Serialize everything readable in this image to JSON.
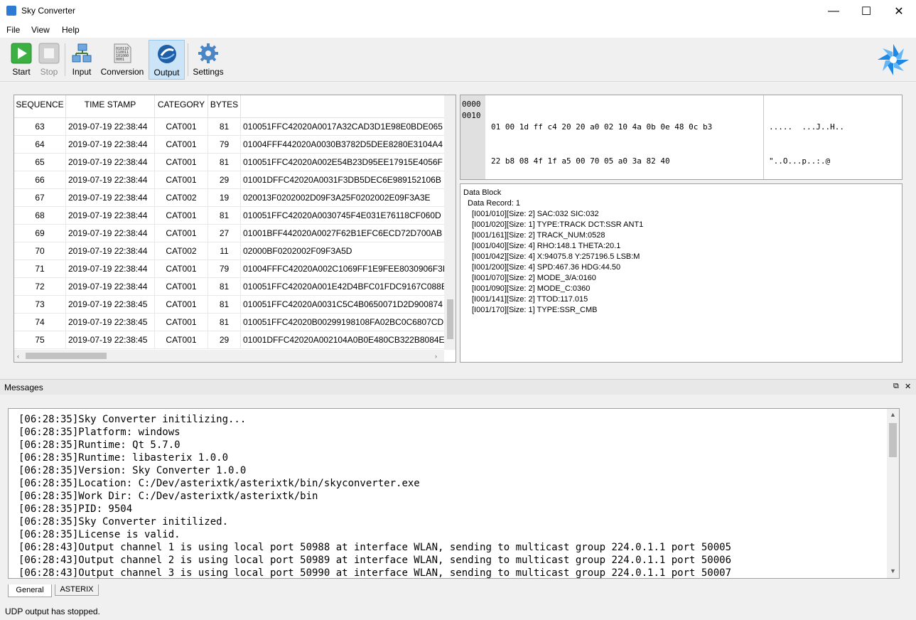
{
  "window": {
    "title": "Sky Converter",
    "minimize": "—",
    "maximize": "☐",
    "close": "✕"
  },
  "menu": [
    "File",
    "View",
    "Help"
  ],
  "toolbar": {
    "buttons": [
      {
        "label": "Start",
        "icon": "play-icon"
      },
      {
        "label": "Stop",
        "icon": "stop-icon"
      },
      {
        "label": "Input",
        "icon": "network-icon"
      },
      {
        "label": "Conversion",
        "icon": "binary-doc-icon"
      },
      {
        "label": "Output",
        "icon": "output-icon"
      },
      {
        "label": "Settings",
        "icon": "gear-icon"
      }
    ]
  },
  "table": {
    "headers": [
      "SEQUENCE",
      "TIME STAMP",
      "CATEGORY",
      "BYTES",
      ""
    ],
    "rows": [
      [
        "63",
        "2019-07-19 22:38:44",
        "CAT001",
        "81",
        "010051FFC42020A0017A32CAD3D1E98E0BDE065"
      ],
      [
        "64",
        "2019-07-19 22:38:44",
        "CAT001",
        "79",
        "01004FFF442020A0030B3782D5DEE8280E3104A4"
      ],
      [
        "65",
        "2019-07-19 22:38:44",
        "CAT001",
        "81",
        "010051FFC42020A002E54B23D95EE17915E4056F"
      ],
      [
        "66",
        "2019-07-19 22:38:44",
        "CAT001",
        "29",
        "01001DFFC42020A0031F3DB5DEC6E989152106B"
      ],
      [
        "67",
        "2019-07-19 22:38:44",
        "CAT002",
        "19",
        "020013F0202002D09F3A25F0202002E09F3A3E"
      ],
      [
        "68",
        "2019-07-19 22:38:44",
        "CAT001",
        "81",
        "010051FFC42020A0030745F4E031E76118CF060D"
      ],
      [
        "69",
        "2019-07-19 22:38:44",
        "CAT001",
        "27",
        "01001BFF442020A0027F62B1EFC6ECD72D700AB"
      ],
      [
        "70",
        "2019-07-19 22:38:44",
        "CAT002",
        "11",
        "02000BF0202002F09F3A5D"
      ],
      [
        "71",
        "2019-07-19 22:38:44",
        "CAT001",
        "79",
        "01004FFFC42020A002C1069FF1E9FEE8030906F3D"
      ],
      [
        "72",
        "2019-07-19 22:38:44",
        "CAT001",
        "81",
        "010051FFC42020A001E42D4BFC01FDC9167C088E"
      ],
      [
        "73",
        "2019-07-19 22:38:45",
        "CAT001",
        "81",
        "010051FFC42020A0031C5C4B0650071D2D900874"
      ],
      [
        "74",
        "2019-07-19 22:38:45",
        "CAT001",
        "81",
        "010051FFC42020B00299198108FA02BC0C6807CD"
      ],
      [
        "75",
        "2019-07-19 22:38:45",
        "CAT001",
        "29",
        "01001DFFC42020A002104A0B0E480CB322B8084E"
      ]
    ]
  },
  "hex": {
    "offsets": [
      "0000",
      "0010"
    ],
    "bytes": [
      "01 00 1d ff c4 20 20 a0 02 10 4a 0b 0e 48 0c b3",
      "22 b8 08 4f 1f a5 00 70 05 a0 3a 82 40"
    ],
    "ascii": [
      ".....  ...J..H..",
      "\"..O...p..:.@"
    ]
  },
  "tree": {
    "root": "Data Block",
    "record": "Data Record: 1",
    "items": [
      "[I001/010][Size: 2] SAC:032 SIC:032",
      "[I001/020][Size: 1] TYPE:TRACK DCT:SSR ANT1",
      "[I001/161][Size: 2] TRACK_NUM:0528",
      "[I001/040][Size: 4] RHO:148.1 THETA:20.1",
      "[I001/042][Size: 4] X:94075.8 Y:257196.5 LSB:M",
      "[I001/200][Size: 4] SPD:467.36 HDG:44.50",
      "[I001/070][Size: 2] MODE_3/A:0160",
      "[I001/090][Size: 2] MODE_C:0360",
      "[I001/141][Size: 2] TTOD:117.015",
      "[I001/170][Size: 1] TYPE:SSR_CMB"
    ]
  },
  "messages": {
    "title": "Messages",
    "lines": [
      "[06:28:35]Sky Converter initilizing...",
      "[06:28:35]Platform: windows",
      "[06:28:35]Runtime: Qt 5.7.0",
      "[06:28:35]Runtime: libasterix 1.0.0",
      "[06:28:35]Version: Sky Converter 1.0.0",
      "[06:28:35]Location: C:/Dev/asterixtk/asterixtk/bin/skyconverter.exe",
      "[06:28:35]Work Dir: C:/Dev/asterixtk/asterixtk/bin",
      "[06:28:35]PID: 9504",
      "[06:28:35]Sky Converter initilized.",
      "[06:28:35]License is valid.",
      "[06:28:43]Output channel 1 is using local port 50988 at interface WLAN, sending to multicast group 224.0.1.1 port 50005",
      "[06:28:43]Output channel 2 is using local port 50989 at interface WLAN, sending to multicast group 224.0.1.1 port 50006",
      "[06:28:43]Output channel 3 is using local port 50990 at interface WLAN, sending to multicast group 224.0.1.1 port 50007"
    ],
    "tabs": [
      "General",
      "ASTERIX"
    ]
  },
  "status": "UDP output has stopped."
}
